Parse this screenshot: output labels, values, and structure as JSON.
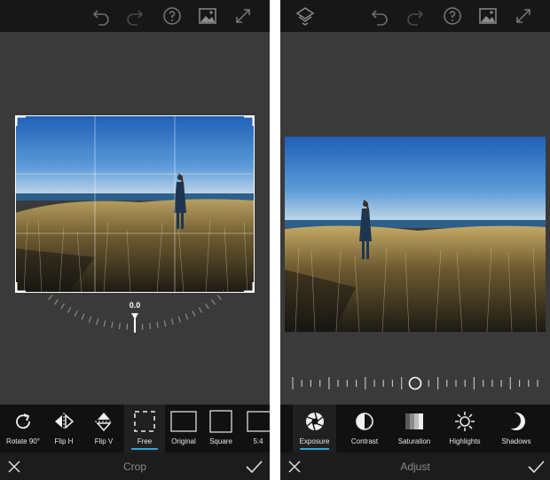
{
  "crop_screen": {
    "topbar_icons": [
      "undo-icon",
      "redo-icon",
      "help-icon",
      "compare-image-icon",
      "fullscreen-icon"
    ],
    "straighten_value": "0.0",
    "tools": [
      {
        "label": "Rotate 90°",
        "icon": "rotate-icon"
      },
      {
        "label": "Flip H",
        "icon": "flip-horizontal-icon"
      },
      {
        "label": "Flip V",
        "icon": "flip-vertical-icon"
      },
      {
        "label": "Free",
        "icon": "free-crop-icon",
        "selected": true
      },
      {
        "label": "Original",
        "icon": "original-ratio-icon"
      },
      {
        "label": "Square",
        "icon": "square-ratio-icon"
      },
      {
        "label": "5:4",
        "icon": "ratio-5-4-icon"
      }
    ],
    "title": "Crop",
    "cancel_icon": "close-icon",
    "confirm_icon": "check-icon"
  },
  "adjust_screen": {
    "topbar_icons": [
      "layers-icon",
      "undo-icon",
      "redo-icon",
      "help-icon",
      "compare-image-icon",
      "fullscreen-icon"
    ],
    "slider_value": 0.5,
    "tools": [
      {
        "label": "Exposure",
        "icon": "exposure-icon",
        "selected": true
      },
      {
        "label": "Contrast",
        "icon": "contrast-icon"
      },
      {
        "label": "Saturation",
        "icon": "saturation-icon"
      },
      {
        "label": "Highlights",
        "icon": "highlights-icon"
      },
      {
        "label": "Shadows",
        "icon": "shadows-icon"
      }
    ],
    "title": "Adjust",
    "cancel_icon": "close-icon",
    "confirm_icon": "check-icon"
  },
  "colors": {
    "accent": "#2fa4d6",
    "background": "#3a3a3a",
    "topbar": "#171717",
    "toolbar": "#111111"
  }
}
